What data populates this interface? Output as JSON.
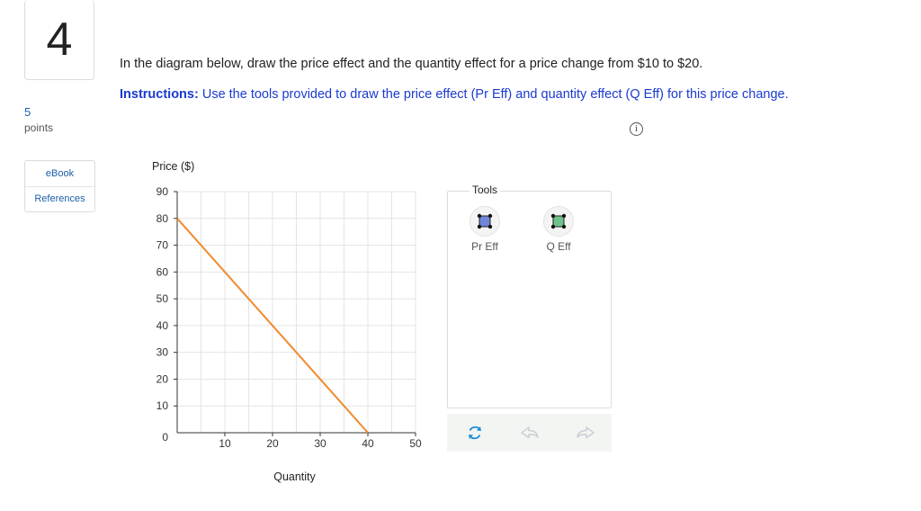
{
  "question": {
    "number": "4",
    "points_value": "5",
    "points_label": "points",
    "links": [
      "eBook",
      "References"
    ],
    "prompt": "In the diagram below, draw the price effect and the quantity effect for a price change from $10 to $20.",
    "instructions_label": "Instructions:",
    "instructions_text": " Use the tools provided to draw the price effect (Pr Eff) and quantity effect (Q Eff) for this price change.",
    "info_glyph": "i"
  },
  "tools": {
    "title": "Tools",
    "items": [
      {
        "label": "Pr Eff",
        "color": "#6f86d8",
        "icon": "rectangle-shape-icon"
      },
      {
        "label": "Q Eff",
        "color": "#6fc38a",
        "icon": "rectangle-shape-icon"
      }
    ],
    "toolbar": [
      "refresh-icon",
      "undo-icon",
      "redo-icon"
    ],
    "accent": "#1a8fd8"
  },
  "chart_data": {
    "type": "line",
    "ylabel": "Price ($)",
    "xlabel": "Quantity",
    "xlim": [
      0,
      50
    ],
    "ylim": [
      0,
      90
    ],
    "x_ticks": [
      10,
      20,
      30,
      40,
      50
    ],
    "y_ticks": [
      10,
      20,
      30,
      40,
      50,
      60,
      70,
      80,
      90
    ],
    "origin_label": "0",
    "grid": true,
    "series": [
      {
        "color": "#f08a2c",
        "points": [
          [
            0,
            80
          ],
          [
            40,
            0
          ]
        ]
      }
    ]
  }
}
